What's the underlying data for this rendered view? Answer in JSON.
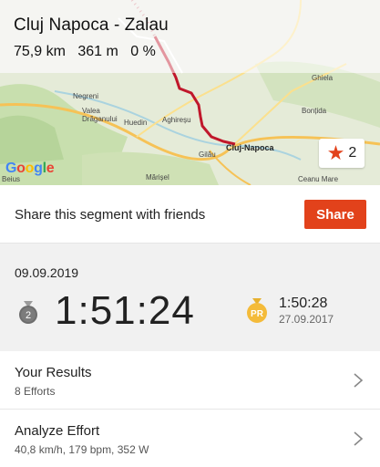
{
  "map": {
    "title": "Cluj Napoca - Zalau",
    "distance": "75,9 km",
    "elevation": "361 m",
    "grade": "0 %",
    "places": [
      "Negreni",
      "Valea Drăganului",
      "Huedin",
      "Aghireșu",
      "Bonțida",
      "Cluj-Napoca",
      "Gilău",
      "Mărișel",
      "Ceanu Mare",
      "Ghiela",
      "Beius"
    ],
    "google_letters": [
      "G",
      "o",
      "o",
      "g",
      "l",
      "e"
    ],
    "star_count": "2",
    "colors": {
      "route": "#c0172b",
      "water": "#aad3df",
      "park": "#c8dfae",
      "road_major": "#f6c256"
    }
  },
  "share": {
    "text": "Share this segment with friends",
    "button_label": "Share",
    "button_color": "#e2421b"
  },
  "effort": {
    "date": "09.09.2019",
    "rank": "2",
    "time": "1:51:24",
    "pr_label": "PR",
    "pr_time": "1:50:28",
    "pr_date": "27.09.2017"
  },
  "rows": [
    {
      "title": "Your Results",
      "subtitle": "8 Efforts"
    },
    {
      "title": "Analyze Effort",
      "subtitle": "40,8 km/h, 179 bpm, 352 W"
    }
  ]
}
